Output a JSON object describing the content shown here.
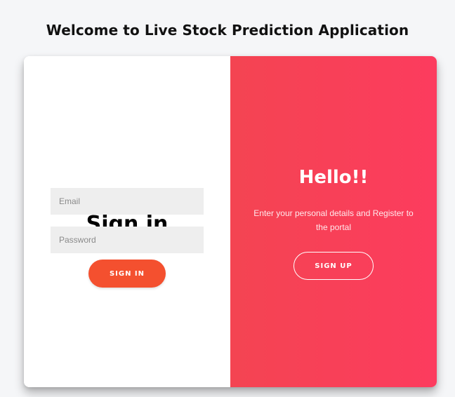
{
  "app": {
    "title": "Welcome to Live Stock Prediction Application"
  },
  "signin": {
    "heading": "Sign in",
    "email_placeholder": "Email",
    "password_placeholder": "Password",
    "button_label": "SIGN IN"
  },
  "signup": {
    "heading": "Hello!!",
    "description": "Enter your personal details and Register to the portal",
    "button_label": "SIGN UP"
  },
  "colors": {
    "page_background": "#f5f6f8",
    "signin_button": "#f4502f",
    "signup_panel_start": "#f44452",
    "signup_panel_end": "#fc3c5e",
    "input_background": "#eeeeee"
  }
}
